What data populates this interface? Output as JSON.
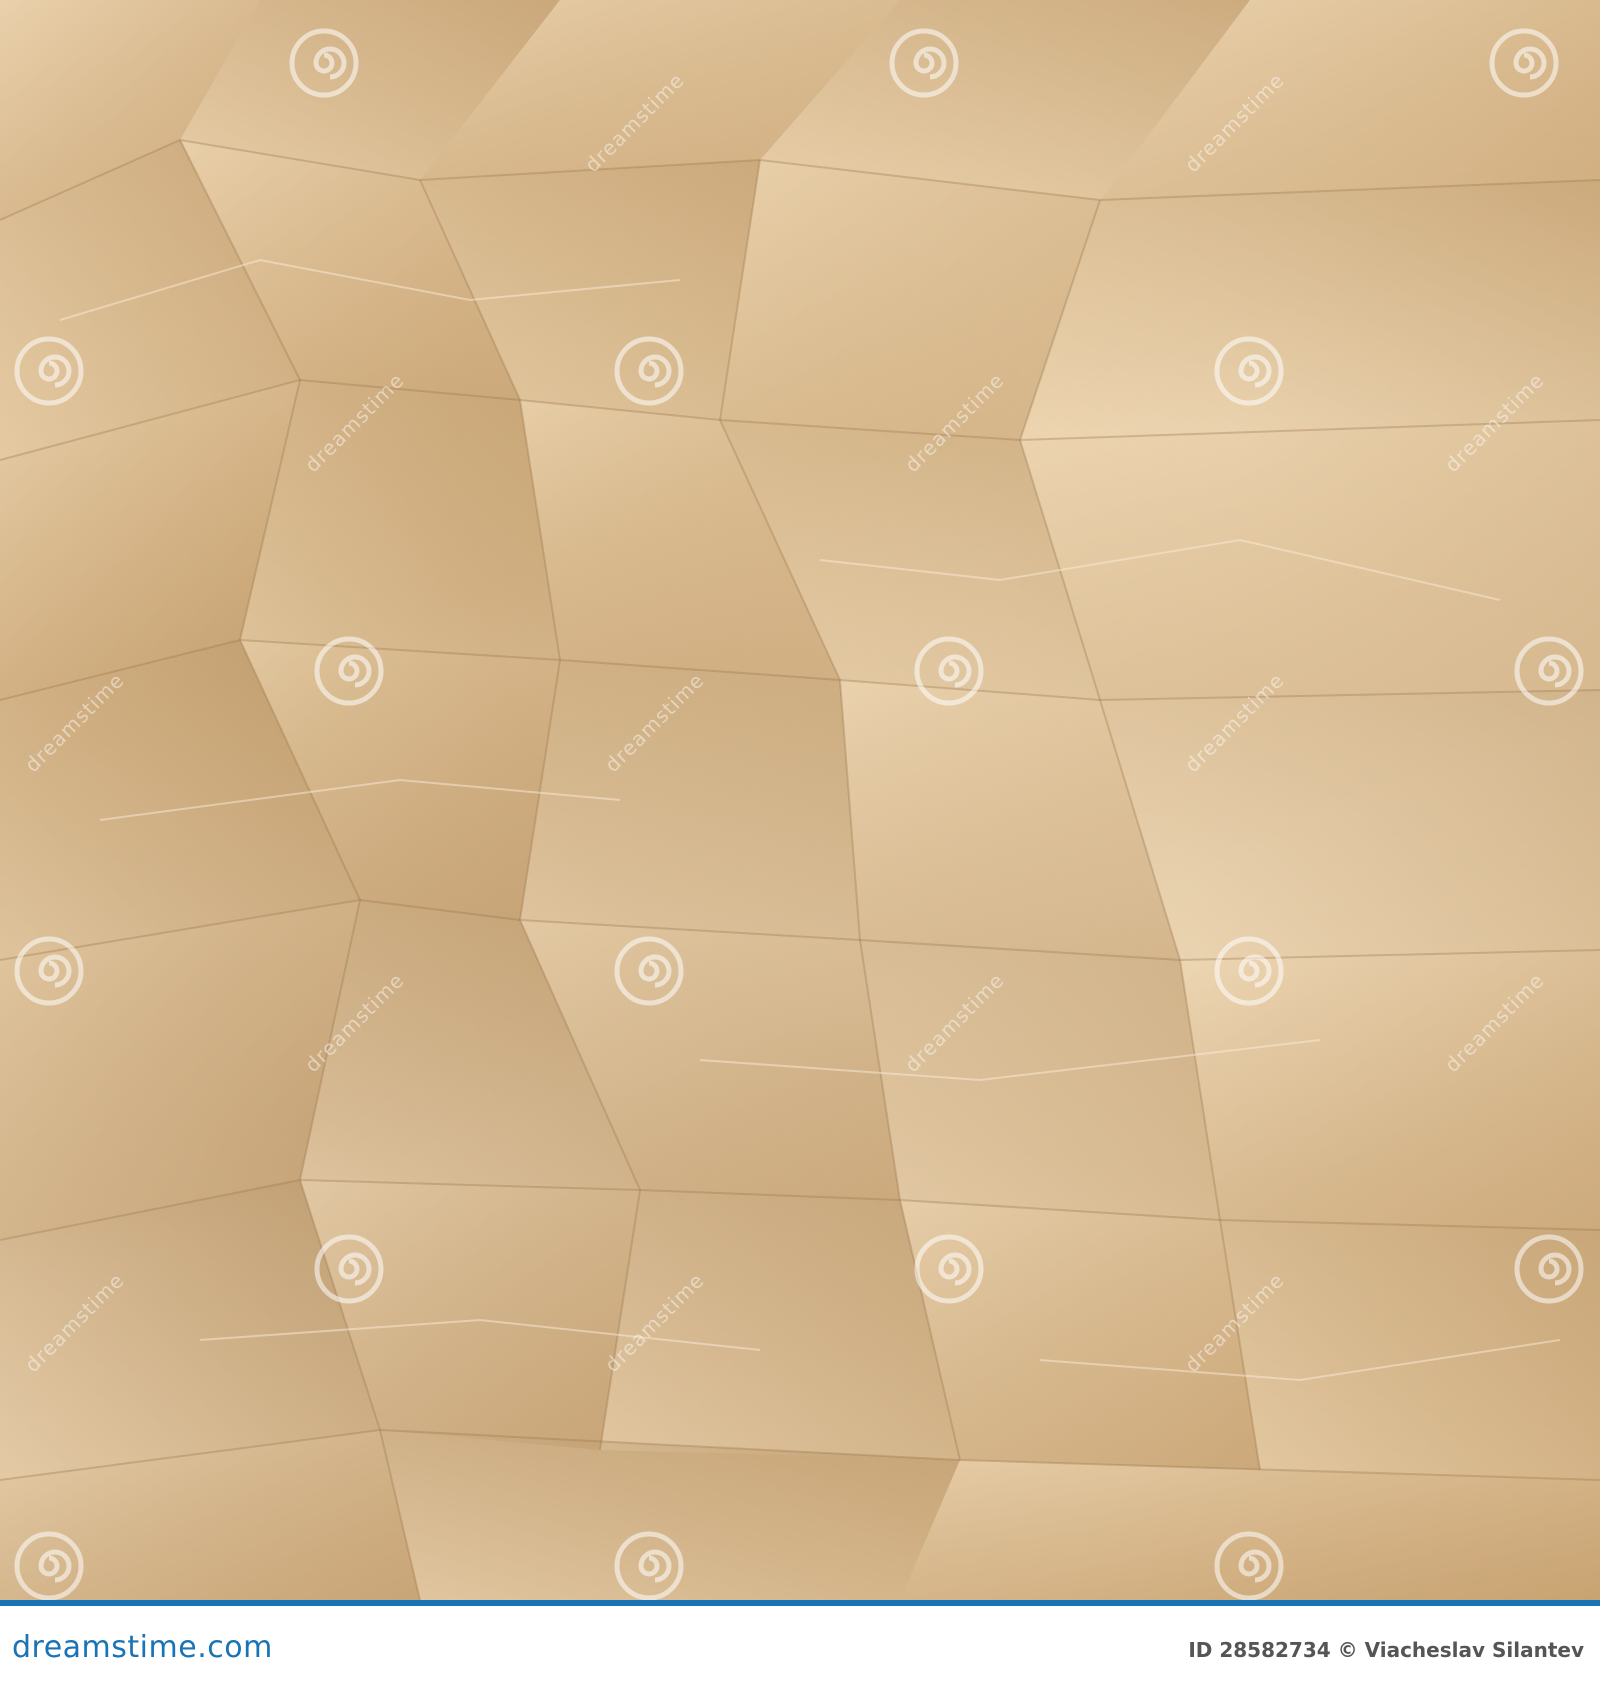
{
  "watermark": {
    "brand": "dreamstime",
    "repeat_text": "dreamstime"
  },
  "footer": {
    "brand_text": "dreamstime.com",
    "credit_text": "ID 28582734 © Viacheslav Silantev",
    "accent_color": "#1a73b5"
  },
  "icons": {
    "watermark": "spiral-logo-icon"
  },
  "colors": {
    "paper_base": "#dcbd8f",
    "paper_highlight": "#f2dfc2",
    "paper_shadow": "#a7804f"
  }
}
